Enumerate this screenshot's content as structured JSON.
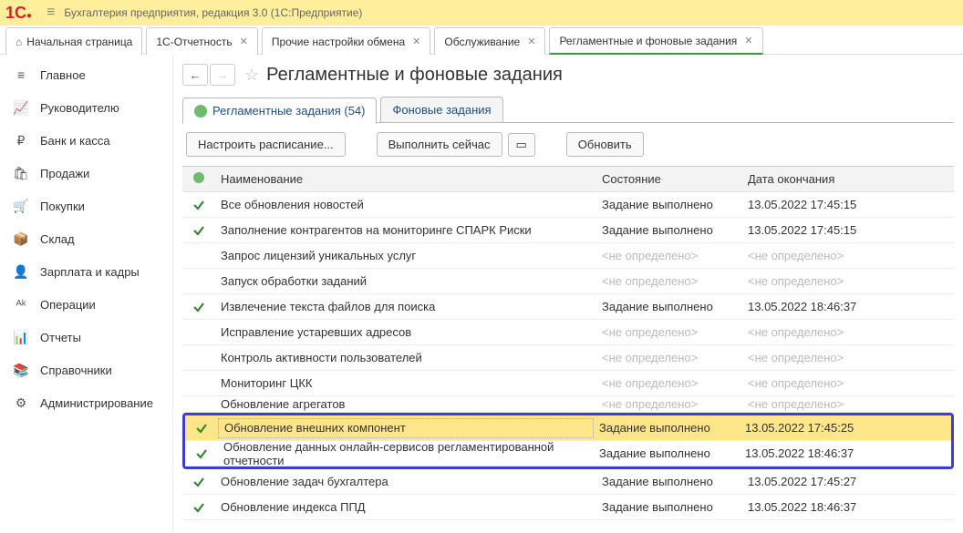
{
  "app": {
    "title": "Бухгалтерия предприятия, редакция 3.0  (1С:Предприятие)"
  },
  "tabs": [
    {
      "label": "Начальная страница",
      "home": true,
      "closable": false,
      "active": false
    },
    {
      "label": "1С-Отчетность",
      "closable": true,
      "active": false
    },
    {
      "label": "Прочие настройки обмена",
      "closable": true,
      "active": false
    },
    {
      "label": "Обслуживание",
      "closable": true,
      "active": false
    },
    {
      "label": "Регламентные и фоновые задания",
      "closable": true,
      "active": true
    }
  ],
  "sidebar": [
    {
      "icon": "≡",
      "label": "Главное"
    },
    {
      "icon": "📈",
      "label": "Руководителю"
    },
    {
      "icon": "₽",
      "label": "Банк и касса"
    },
    {
      "icon": "🛍",
      "label": "Продажи"
    },
    {
      "icon": "🛒",
      "label": "Покупки"
    },
    {
      "icon": "📦",
      "label": "Склад"
    },
    {
      "icon": "👤",
      "label": "Зарплата и кадры"
    },
    {
      "icon": "ᴬᵏ",
      "label": "Операции"
    },
    {
      "icon": "📊",
      "label": "Отчеты"
    },
    {
      "icon": "📚",
      "label": "Справочники"
    },
    {
      "icon": "⚙",
      "label": "Администрирование"
    }
  ],
  "page": {
    "title": "Регламентные и фоновые задания",
    "subtabs": [
      {
        "label": "Регламентные задания (54)",
        "active": true,
        "globe": true
      },
      {
        "label": "Фоновые задания",
        "active": false,
        "globe": false
      }
    ],
    "toolbar": {
      "schedule": "Настроить расписание...",
      "run_now": "Выполнить сейчас",
      "refresh": "Обновить"
    },
    "columns": {
      "name": "Наименование",
      "state": "Состояние",
      "end_date": "Дата окончания"
    },
    "done_text": "Задание выполнено",
    "undef_text": "<не определено>",
    "rows": [
      {
        "chk": true,
        "name": "Все обновления новостей",
        "state": "done",
        "date": "13.05.2022 17:45:15"
      },
      {
        "chk": true,
        "name": "Заполнение контрагентов на мониторинге СПАРК Риски",
        "state": "done",
        "date": "13.05.2022 17:45:15"
      },
      {
        "chk": false,
        "name": "Запрос лицензий уникальных услуг",
        "state": "undef"
      },
      {
        "chk": false,
        "name": "Запуск обработки заданий",
        "state": "undef"
      },
      {
        "chk": true,
        "name": "Извлечение текста файлов для поиска",
        "state": "done",
        "date": "13.05.2022 18:46:37"
      },
      {
        "chk": false,
        "name": "Исправление устаревших адресов",
        "state": "undef"
      },
      {
        "chk": false,
        "name": "Контроль активности пользователей",
        "state": "undef"
      },
      {
        "chk": false,
        "name": "Мониторинг ЦКК",
        "state": "undef"
      },
      {
        "chk": false,
        "name": "Обновление агрегатов",
        "state": "undef",
        "cut": true
      }
    ],
    "highlighted_rows": [
      {
        "chk": true,
        "name": "Обновление внешних компонент",
        "state": "done",
        "date": "13.05.2022 17:45:25",
        "hl": true
      },
      {
        "chk": true,
        "name": "Обновление данных онлайн-сервисов регламентированной отчетности",
        "state": "done",
        "date": "13.05.2022 18:46:37"
      }
    ],
    "rows_after": [
      {
        "chk": true,
        "name": "Обновление задач бухгалтера",
        "state": "done",
        "date": "13.05.2022 17:45:27"
      },
      {
        "chk": true,
        "name": "Обновление индекса ППД",
        "state": "done",
        "date": "13.05.2022 18:46:37"
      }
    ]
  }
}
